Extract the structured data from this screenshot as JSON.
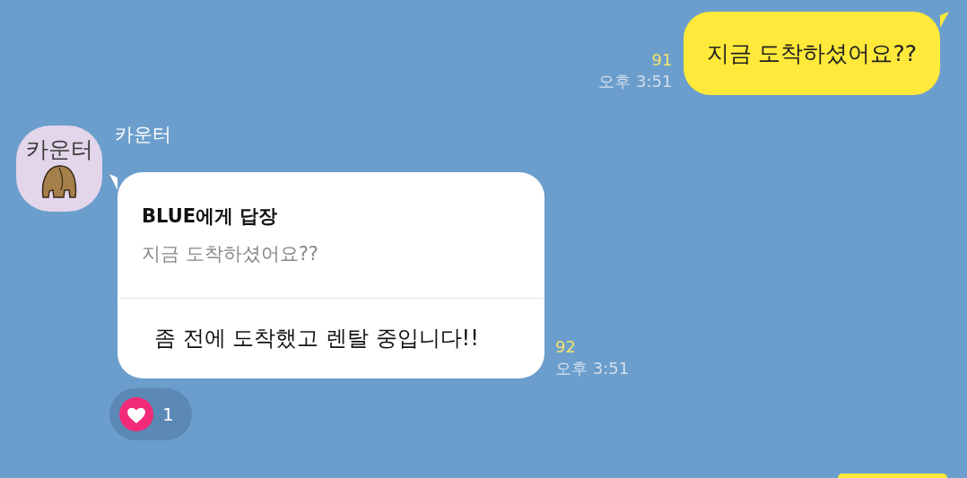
{
  "messages": [
    {
      "kind": "outgoing",
      "text": "지금 도착하셨어요??",
      "unread": "91",
      "time": "오후 3:51"
    },
    {
      "kind": "incoming",
      "avatar_text": "카운터",
      "sender": "카운터",
      "reply": {
        "title": "BLUE에게 답장",
        "quote": "지금 도착하셨어요??"
      },
      "text": "좀 전에 도착했고 렌탈 중입니다!!",
      "unread": "92",
      "time": "오후 3:51",
      "reactions": [
        {
          "kind": "heart",
          "count": "1"
        }
      ]
    },
    {
      "kind": "outgoing-cut"
    }
  ]
}
